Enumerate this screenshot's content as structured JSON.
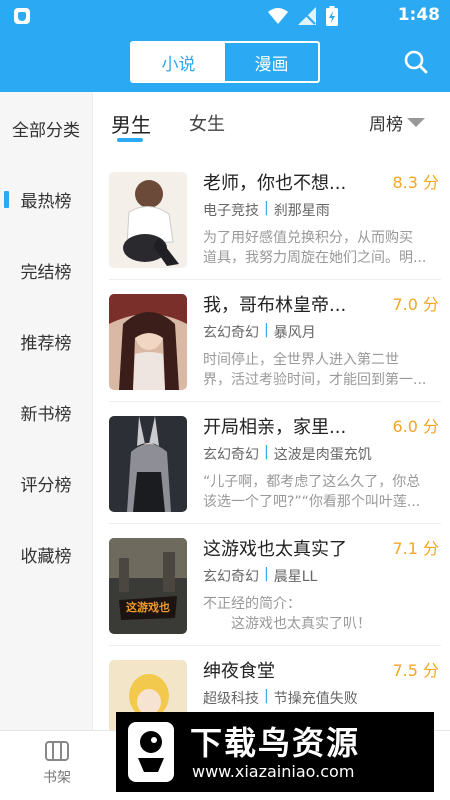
{
  "status": {
    "time": "1:48"
  },
  "header": {
    "tabs": [
      {
        "label": "小说"
      },
      {
        "label": "漫画"
      }
    ]
  },
  "sidebar": {
    "items": [
      {
        "label": "全部分类"
      },
      {
        "label": "最热榜"
      },
      {
        "label": "完结榜"
      },
      {
        "label": "推荐榜"
      },
      {
        "label": "新书榜"
      },
      {
        "label": "评分榜"
      },
      {
        "label": "收藏榜"
      }
    ]
  },
  "gender_tabs": {
    "male": "男生",
    "female": "女生"
  },
  "rank_period": "周榜",
  "books": [
    {
      "title": "老师，你也不想...",
      "score": "8.3 分",
      "category": "电子竞技",
      "author": "刹那星雨",
      "desc": [
        "为了用好感值兑换积分，从而购买",
        "道具，我努力周旋在她们之间。明..."
      ]
    },
    {
      "title": "我，哥布林皇帝...",
      "score": "7.0 分",
      "category": "玄幻奇幻",
      "author": "暴风月",
      "desc": [
        "时间停止，全世界人进入第二世",
        "界，活过考验时间，才能回到第一..."
      ]
    },
    {
      "title": "开局相亲，家里...",
      "score": "6.0 分",
      "category": "玄幻奇幻",
      "author": "这波是肉蛋充饥",
      "desc": [
        "“儿子啊，都考虑了这么久了，你总",
        "该选一个了吧?”“你看那个叫叶莲..."
      ]
    },
    {
      "title": "这游戏也太真实了",
      "score": "7.1 分",
      "category": "玄幻奇幻",
      "author": "晨星LL",
      "desc": [
        "不正经的简介：",
        "　　这游戏也太真实了叭！"
      ]
    },
    {
      "title": "绅夜食堂",
      "score": "7.5 分",
      "category": "超级科技",
      "author": "节操充值失败",
      "desc": [
        "",
        ""
      ]
    }
  ],
  "bottom_nav": {
    "shelf": "书架"
  },
  "watermark": {
    "main": "下载鸟资源",
    "sub": "www.xiazainiao.com"
  },
  "colors": {
    "primary": "#2ba9f3",
    "score": "#f5a623"
  }
}
